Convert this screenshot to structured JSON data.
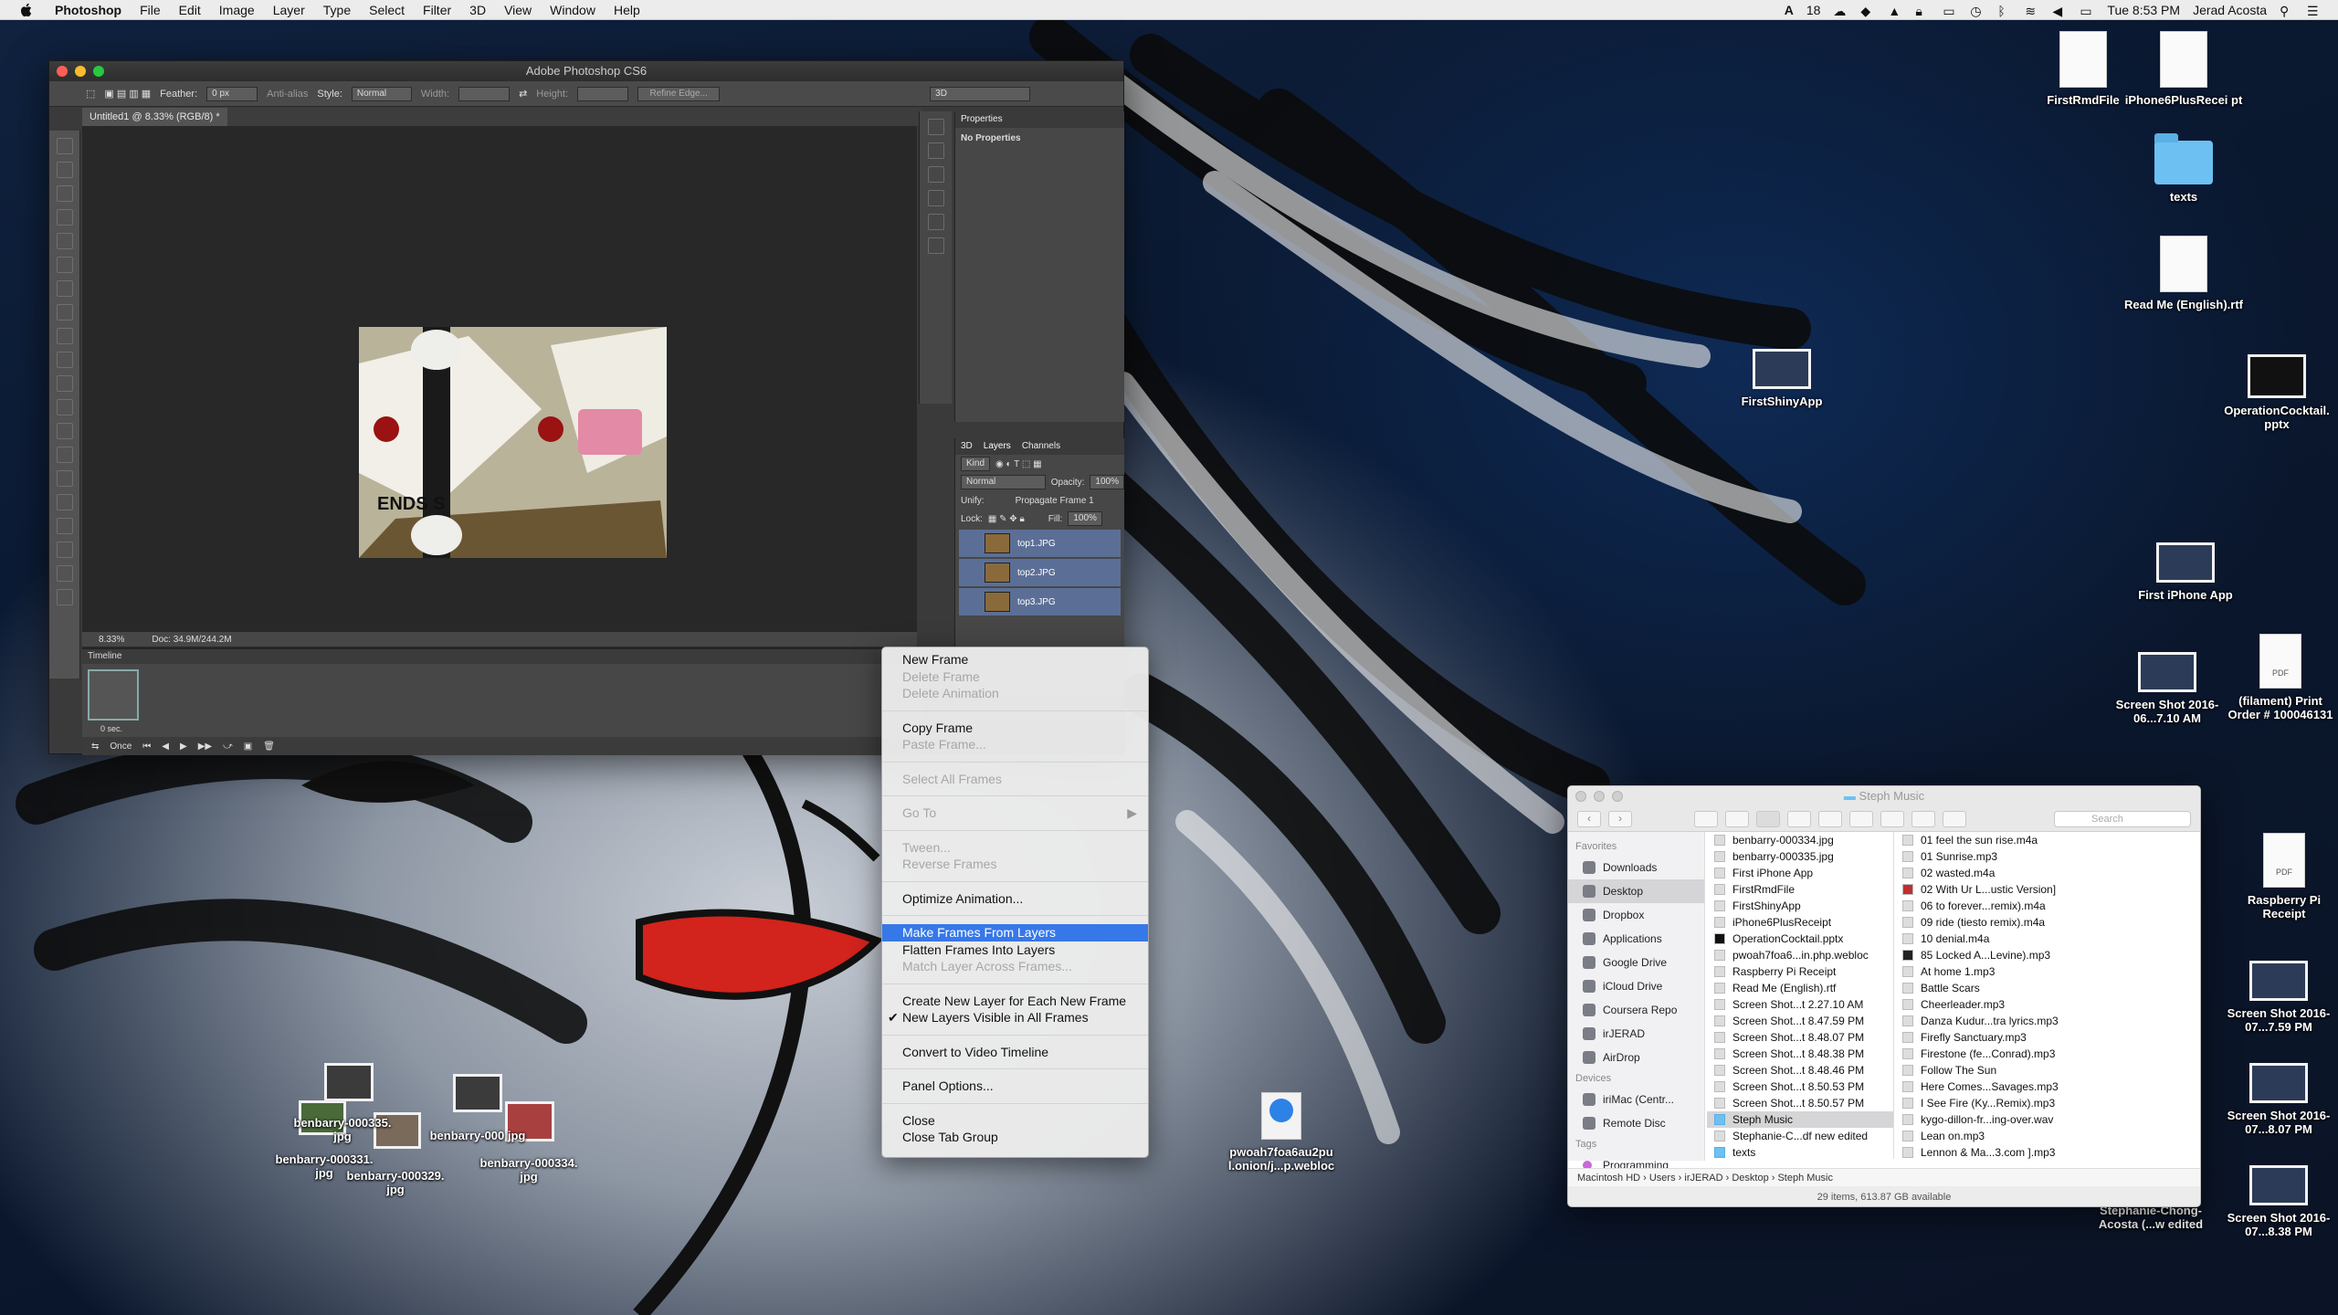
{
  "menubar": {
    "app": "Photoshop",
    "items": [
      "File",
      "Edit",
      "Image",
      "Layer",
      "Type",
      "Select",
      "Filter",
      "3D",
      "View",
      "Window",
      "Help"
    ],
    "status_text": "18",
    "clock": "Tue 8:53 PM",
    "user": "Jerad Acosta"
  },
  "photoshop": {
    "window_title": "Adobe Photoshop CS6",
    "options": {
      "feather_label": "Feather:",
      "feather_value": "0 px",
      "antialias": "Anti-alias",
      "style_label": "Style:",
      "style_value": "Normal",
      "width_label": "Width:",
      "height_label": "Height:",
      "refine": "Refine Edge...",
      "workspace": "3D"
    },
    "doc_tab": "Untitled1 @ 8.33% (RGB/8) *",
    "status": {
      "zoom": "8.33%",
      "doc": "Doc: 34.9M/244.2M"
    },
    "timeline": {
      "title": "Timeline",
      "frame_delay": "0 sec.",
      "loop": "Once"
    },
    "properties": {
      "title": "Properties",
      "body": "No Properties"
    },
    "layers_panel": {
      "tabs": [
        "3D",
        "Layers",
        "Channels"
      ],
      "kind": "Kind",
      "blend": "Normal",
      "opacity_label": "Opacity:",
      "opacity": "100%",
      "unify": "Unify:",
      "propagate": "Propagate Frame 1",
      "lock": "Lock:",
      "fill_label": "Fill:",
      "fill": "100%",
      "layers": [
        "top1.JPG",
        "top2.JPG",
        "top3.JPG"
      ]
    }
  },
  "context_menu": {
    "groups": [
      [
        {
          "label": "New Frame",
          "enabled": true
        },
        {
          "label": "Delete Frame",
          "enabled": false
        },
        {
          "label": "Delete Animation",
          "enabled": false
        }
      ],
      [
        {
          "label": "Copy Frame",
          "enabled": true
        },
        {
          "label": "Paste Frame...",
          "enabled": false
        }
      ],
      [
        {
          "label": "Select All Frames",
          "enabled": false
        }
      ],
      [
        {
          "label": "Go To",
          "enabled": false,
          "submenu": true
        }
      ],
      [
        {
          "label": "Tween...",
          "enabled": false
        },
        {
          "label": "Reverse Frames",
          "enabled": false
        }
      ],
      [
        {
          "label": "Optimize Animation...",
          "enabled": true
        }
      ],
      [
        {
          "label": "Make Frames From Layers",
          "enabled": true,
          "highlighted": true
        },
        {
          "label": "Flatten Frames Into Layers",
          "enabled": true
        },
        {
          "label": "Match Layer Across Frames...",
          "enabled": false
        }
      ],
      [
        {
          "label": "Create New Layer for Each New Frame",
          "enabled": true
        },
        {
          "label": "New Layers Visible in All Frames",
          "enabled": true,
          "checked": true
        }
      ],
      [
        {
          "label": "Convert to Video Timeline",
          "enabled": true
        }
      ],
      [
        {
          "label": "Panel Options...",
          "enabled": true
        }
      ],
      [
        {
          "label": "Close",
          "enabled": true
        },
        {
          "label": "Close Tab Group",
          "enabled": true
        }
      ]
    ]
  },
  "finder": {
    "title": "Steph Music",
    "search_placeholder": "Search",
    "sidebar": {
      "favorites_header": "Favorites",
      "favorites": [
        "Downloads",
        "Desktop",
        "Dropbox",
        "Applications",
        "Google Drive",
        "iCloud Drive",
        "Coursera Repo",
        "irJERAD",
        "AirDrop"
      ],
      "devices_header": "Devices",
      "devices": [
        "iriMac (Centr...",
        "Remote Disc"
      ],
      "tags_header": "Tags",
      "tags": [
        "Programming"
      ]
    },
    "column1": [
      "benbarry-000334.jpg",
      "benbarry-000335.jpg",
      "First iPhone App",
      "FirstRmdFile",
      "FirstShinyApp",
      "iPhone6PlusReceipt",
      "OperationCocktail.pptx",
      "pwoah7foa6...in.php.webloc",
      "Raspberry Pi Receipt",
      "Read Me (English).rtf",
      "Screen Shot...t 2.27.10 AM",
      "Screen Shot...t 8.47.59 PM",
      "Screen Shot...t 8.48.07 PM",
      "Screen Shot...t 8.48.38 PM",
      "Screen Shot...t 8.48.46 PM",
      "Screen Shot...t 8.50.53 PM",
      "Screen Shot...t 8.50.57 PM",
      "Steph Music",
      "Stephanie-C...df new edited",
      "texts"
    ],
    "column2": [
      "01 feel the sun rise.m4a",
      "01 Sunrise.mp3",
      "02 wasted.m4a",
      "02 With Ur L...ustic Version]",
      "06 to forever...remix).m4a",
      "09 ride (tiesto remix).m4a",
      "10 denial.m4a",
      "85 Locked A...Levine).mp3",
      "At home 1.mp3",
      "Battle Scars",
      "Cheerleader.mp3",
      "Danza Kudur...tra lyrics.mp3",
      "Firefly Sanctuary.mp3",
      "Firestone (fe...Conrad).mp3",
      "Follow The Sun",
      "Here Comes...Savages.mp3",
      "I See Fire (Ky...Remix).mp3",
      "kygo-dillon-fr...ing-over.wav",
      "Lean on.mp3",
      "Lennon & Ma...3.com ].mp3"
    ],
    "path": [
      "Macintosh HD",
      "Users",
      "irJERAD",
      "Desktop",
      "Steph Music"
    ],
    "status": "29 items, 613.87 GB available"
  },
  "desktop_icons": [
    {
      "label": "FirstRmdFile",
      "kind": "doc"
    },
    {
      "label": "iPhone6PlusRecei pt",
      "kind": "doc"
    },
    {
      "label": "texts",
      "kind": "folder"
    },
    {
      "label": "Read Me (English).rtf",
      "kind": "doc"
    },
    {
      "label": "FirstShinyApp",
      "kind": "shot"
    },
    {
      "label": "OperationCocktail. pptx",
      "kind": "pptx"
    },
    {
      "label": "First iPhone App",
      "kind": "shot"
    },
    {
      "label": "Screen Shot 2016-06...7.10 AM",
      "kind": "shot"
    },
    {
      "label": "(filament) Print Order # 100046131",
      "kind": "pdf"
    },
    {
      "label": "Raspberry Pi Receipt",
      "kind": "pdf"
    },
    {
      "label": "Screen Shot 2016-07...7.59 PM",
      "kind": "shot"
    },
    {
      "label": "Screen Shot 2016-07...8.07 PM",
      "kind": "shot"
    },
    {
      "label": "Screen Shot 2016-07...8.38 PM",
      "kind": "shot"
    },
    {
      "label": "Stephanie-Chong- Acosta (...w edited",
      "kind": "doc"
    },
    {
      "label": "pwoah7foa6au2pu l.onion/j...p.webloc",
      "kind": "webloc"
    },
    {
      "label": "benbarry-000335. jpg",
      "kind": "jpg"
    },
    {
      "label": "benbarry-000331. jpg",
      "kind": "jpg"
    },
    {
      "label": "benbarry-000329. jpg",
      "kind": "jpg"
    },
    {
      "label": "benbarry-000 jpg",
      "kind": "jpg"
    },
    {
      "label": "benbarry-000334. jpg",
      "kind": "jpg"
    }
  ]
}
